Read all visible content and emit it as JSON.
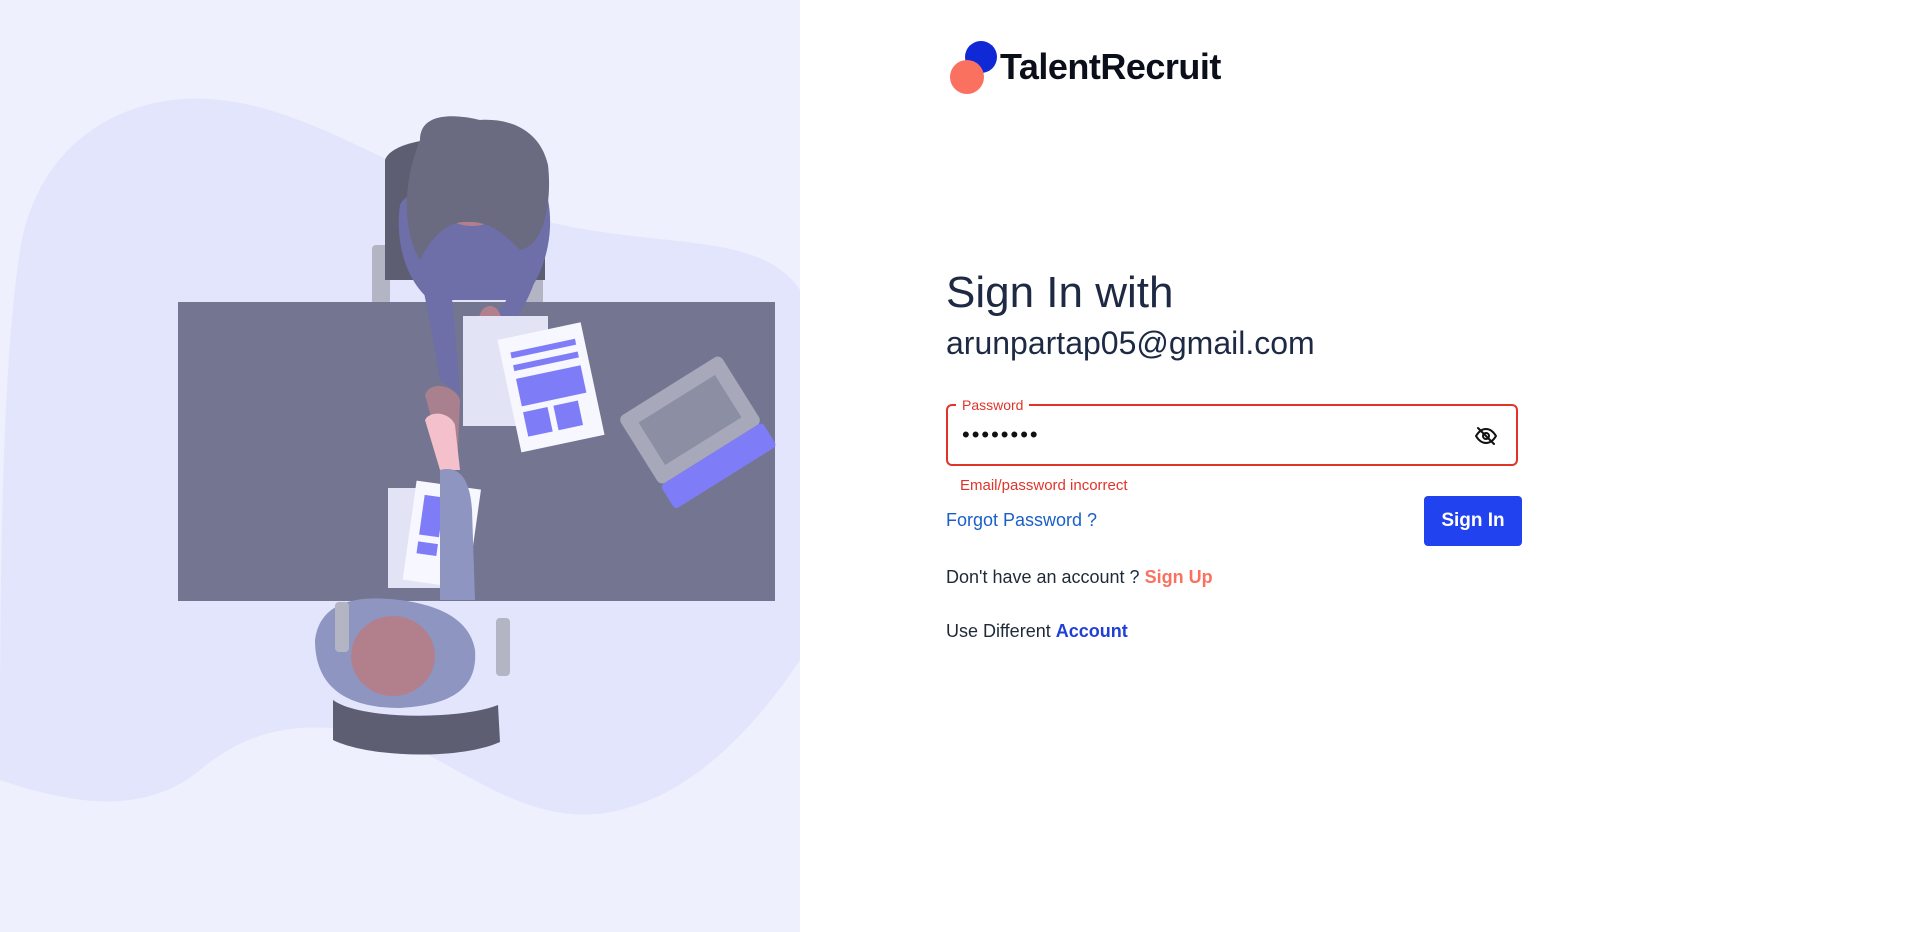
{
  "brand": {
    "name": "TalentRecruit"
  },
  "signin": {
    "heading": "Sign In with",
    "email": "arunpartap05@gmail.com",
    "password_label": "Password",
    "password_value": "••••••••",
    "error": "Email/password incorrect",
    "forgot_password": "Forgot Password ?",
    "submit": "Sign In",
    "no_account_text": "Don't have an account ?",
    "signup_link": "Sign Up",
    "different_text": "Use Different",
    "account_link": "Account"
  },
  "icons": {
    "password_toggle": "eye-off-icon"
  },
  "colors": {
    "primary": "#2142ef",
    "accent": "#fb7160",
    "error": "#e0342a",
    "link": "#1a5fc9",
    "panel_bg": "#eef0fd"
  }
}
